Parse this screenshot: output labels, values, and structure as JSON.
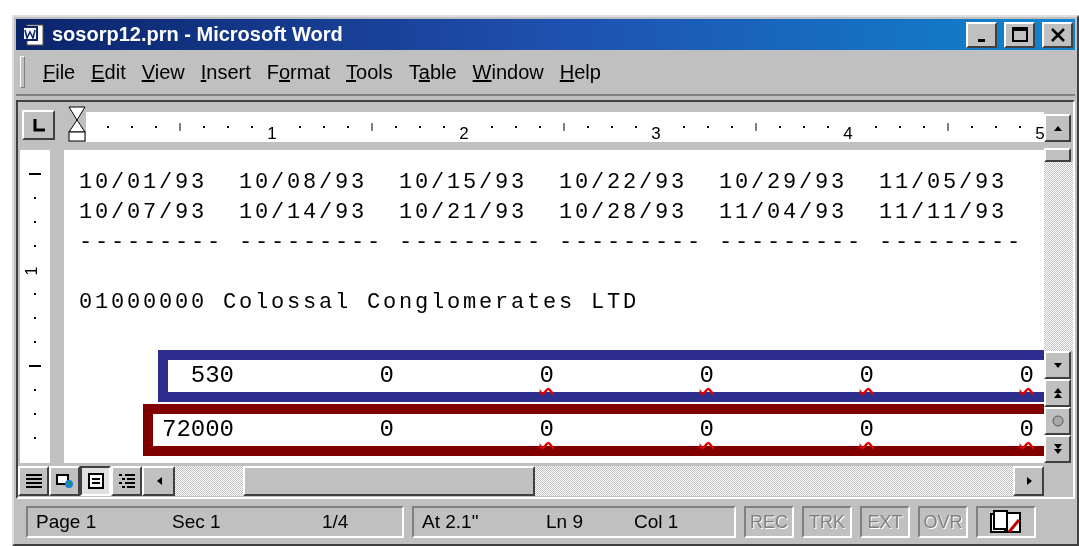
{
  "window": {
    "title": "sosorp12.prn - Microsoft Word"
  },
  "menu": [
    {
      "parts": [
        {
          "text": "F",
          "underlined": true
        },
        {
          "text": "ile",
          "underlined": false
        }
      ]
    },
    {
      "parts": [
        {
          "text": "E",
          "underlined": true
        },
        {
          "text": "dit",
          "underlined": false
        }
      ]
    },
    {
      "parts": [
        {
          "text": "V",
          "underlined": true
        },
        {
          "text": "iew",
          "underlined": false
        }
      ]
    },
    {
      "parts": [
        {
          "text": "I",
          "underlined": true
        },
        {
          "text": "nsert",
          "underlined": false
        }
      ]
    },
    {
      "parts": [
        {
          "text": "F",
          "underlined": false
        },
        {
          "text": "o",
          "underlined": true
        },
        {
          "text": "rmat",
          "underlined": false
        }
      ]
    },
    {
      "parts": [
        {
          "text": "T",
          "underlined": true
        },
        {
          "text": "ools",
          "underlined": false
        }
      ]
    },
    {
      "parts": [
        {
          "text": "T",
          "underlined": false
        },
        {
          "text": "a",
          "underlined": true
        },
        {
          "text": "ble",
          "underlined": false
        }
      ]
    },
    {
      "parts": [
        {
          "text": "W",
          "underlined": true
        },
        {
          "text": "indow",
          "underlined": false
        }
      ]
    },
    {
      "parts": [
        {
          "text": "H",
          "underlined": true
        },
        {
          "text": "elp",
          "underlined": false
        }
      ]
    }
  ],
  "ruler": {
    "labels": [
      "1",
      "2",
      "3",
      "4",
      "5"
    ],
    "vertical_labels": [
      "1"
    ]
  },
  "document": {
    "date_lines": [
      [
        "10/01/93",
        "10/08/93",
        "10/15/93",
        "10/22/93",
        "10/29/93",
        "11/05/93"
      ],
      [
        "10/07/93",
        "10/14/93",
        "10/21/93",
        "10/28/93",
        "11/04/93",
        "11/11/93"
      ],
      [
        "---------",
        "---------",
        "---------",
        "---------",
        "---------",
        "---------"
      ]
    ],
    "company": "01000000 Colossal Conglomerates LTD",
    "rows": [
      {
        "color": "#2e2e8e",
        "cells": [
          {
            "text": "530",
            "flagged": false
          },
          {
            "text": "0",
            "flagged": false
          },
          {
            "text": "0",
            "flagged": true
          },
          {
            "text": "0",
            "flagged": true
          },
          {
            "text": "0",
            "flagged": true
          },
          {
            "text": "0",
            "flagged": true
          }
        ]
      },
      {
        "color": "#800000",
        "cells": [
          {
            "text": "72000",
            "flagged": false
          },
          {
            "text": "0",
            "flagged": false
          },
          {
            "text": "0",
            "flagged": true
          },
          {
            "text": "0",
            "flagged": true
          },
          {
            "text": "0",
            "flagged": true
          },
          {
            "text": "0",
            "flagged": true
          }
        ]
      }
    ]
  },
  "view_buttons": [
    {
      "kind": "normal",
      "selected": false
    },
    {
      "kind": "web",
      "selected": false
    },
    {
      "kind": "print",
      "selected": true
    },
    {
      "kind": "outline",
      "selected": false
    }
  ],
  "status_bar": {
    "position": [
      "Page 1",
      "Sec 1",
      "1/4"
    ],
    "cursor": [
      "At 2.1\"",
      "Ln 9",
      "Col 1"
    ],
    "modes": [
      {
        "label": "REC",
        "disabled": true
      },
      {
        "label": "TRK",
        "disabled": true
      },
      {
        "label": "EXT",
        "disabled": true
      },
      {
        "label": "OVR",
        "disabled": true
      }
    ]
  }
}
